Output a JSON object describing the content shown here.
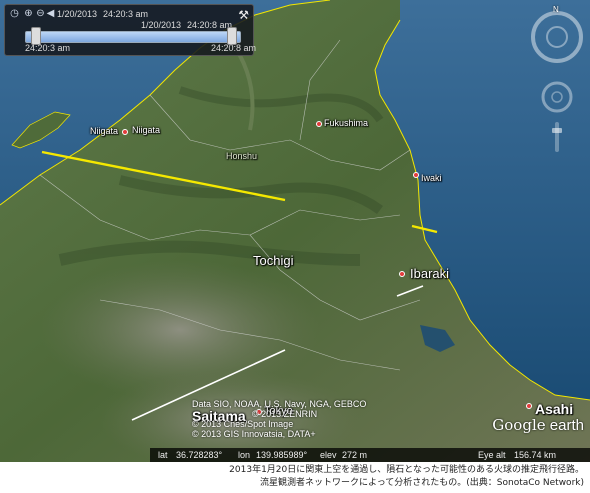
{
  "time_slider": {
    "start_date": "1/20/2013",
    "start_time": "24:20:3 am",
    "end_date": "1/20/2013",
    "end_time": "24:20:8 am",
    "range_start_label": "24:20:3 am",
    "range_end_label": "24:20:8 am"
  },
  "places": {
    "niigata_1": "Niigata",
    "niigata_2": "Niigata",
    "fukushima": "Fukushima",
    "honshu": "Honshu",
    "iwaki": "Iwaki",
    "tochigi": "Tochigi",
    "ibaraki": "Ibaraki",
    "saitama": "Saitama",
    "tokyo": "Tokyo",
    "asahi": "Asahi"
  },
  "attribution": {
    "line1": "Data SIO, NOAA, U.S. Navy, NGA, GEBCO",
    "line2": "© 2013 ZENRIN",
    "line3": "© 2013 Cnes/Spot Image",
    "line4": "© 2013 GIS Innovatsia, DATA+"
  },
  "status_bar": {
    "lat_label": "lat",
    "lat_value": "36.728283°",
    "lon_label": "lon",
    "lon_value": "139.985989°",
    "elev_label": "elev",
    "elev_value": "272 m",
    "eye_alt_label": "Eye alt",
    "eye_alt_value": "156.74 km"
  },
  "logo": {
    "google": "Google",
    "earth": "earth"
  },
  "compass": {
    "north": "N"
  },
  "caption": {
    "line1": "2013年1月20日に関東上空を通過し、隕石となった可能性のある火球の推定飛行径路。",
    "line2": "流星観測者ネットワークによって分析されたもの。(出典：SonotaCo Network)"
  },
  "colors": {
    "ocean": "#1b4f7a",
    "land": "#4f6a3a",
    "coastline": "#f2e600",
    "track_yellow": "#f5e800",
    "track_white": "#ffffff"
  }
}
